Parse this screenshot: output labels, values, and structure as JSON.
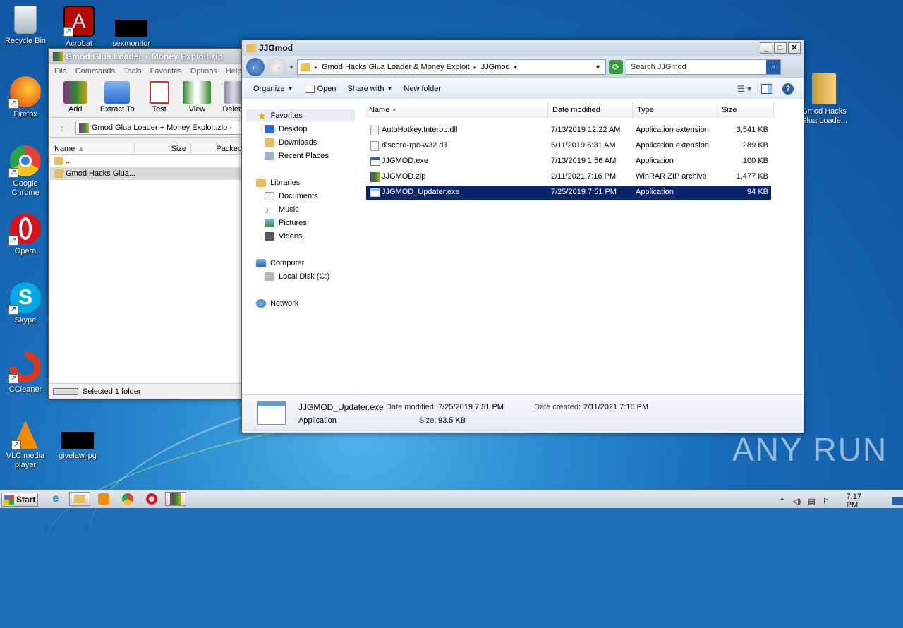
{
  "desktop": {
    "icons": [
      {
        "label": "Recycle Bin",
        "icon": "recycle-bin-icon",
        "color": "#cfd8e0"
      },
      {
        "label": "Firefox",
        "icon": "firefox-icon",
        "color": "#f07a20"
      },
      {
        "label": "Google Chrome",
        "icon": "chrome-icon",
        "color": "#e34133"
      },
      {
        "label": "Opera",
        "icon": "opera-icon",
        "color": "#d8121b"
      },
      {
        "label": "Skype",
        "icon": "skype-icon",
        "color": "#00a8e6"
      },
      {
        "label": "CCleaner",
        "icon": "ccleaner-icon",
        "color": "#d93a1e"
      },
      {
        "label": "VLC media player",
        "icon": "vlc-icon",
        "color": "#f28c00"
      },
      {
        "label": "Acrobat",
        "icon": "acrobat-icon",
        "color": "#b30b00"
      },
      {
        "label": "sexmonitor",
        "icon": "redacted-icon",
        "color": "#000000"
      },
      {
        "label": "givelaw.jpg",
        "icon": "image-thumbnail-icon",
        "color": "#000000"
      },
      {
        "label": "Gmod Hacks Glua Loade...",
        "icon": "folder-icon",
        "color": "#e8c060"
      }
    ],
    "watermark": "ANY RUN"
  },
  "winrar": {
    "title": "Gmod Glua Loader + Money Exploit.zip",
    "menu": [
      "File",
      "Commands",
      "Tools",
      "Favorites",
      "Options",
      "Help"
    ],
    "toolbar": [
      "Add",
      "Extract To",
      "Test",
      "View",
      "Delete"
    ],
    "path": "Gmod Glua Loader + Money Exploit.zip -",
    "columns": [
      "Name",
      "Size",
      "Packed"
    ],
    "rows": [
      "..",
      "Gmod Hacks Glua..."
    ],
    "status": "Selected 1 folder"
  },
  "explorer": {
    "title": "JJGmod",
    "breadcrumb": [
      "Gmod Hacks Glua Loader & Money Exploit",
      "JJGmod"
    ],
    "search_placeholder": "Search JJGmod",
    "toolbar": {
      "organize": "Organize",
      "open": "Open",
      "share": "Share with",
      "new_folder": "New folder"
    },
    "nav": {
      "favorites": "Favorites",
      "desktop": "Desktop",
      "downloads": "Downloads",
      "recent": "Recent Places",
      "libraries": "Libraries",
      "documents": "Documents",
      "music": "Music",
      "pictures": "Pictures",
      "videos": "Videos",
      "computer": "Computer",
      "local_disk": "Local Disk (C:)",
      "network": "Network"
    },
    "columns": {
      "name": "Name",
      "date": "Date modified",
      "type": "Type",
      "size": "Size"
    },
    "files": [
      {
        "name": "AutoHotkey.Interop.dll",
        "date": "7/13/2019 12:22 AM",
        "type": "Application extension",
        "size": "3,541 KB",
        "icon": "dll-icon"
      },
      {
        "name": "discord-rpc-w32.dll",
        "date": "6/11/2019 6:31 AM",
        "type": "Application extension",
        "size": "289 KB",
        "icon": "dll-icon"
      },
      {
        "name": "JJGMOD.exe",
        "date": "7/13/2019 1:56 AM",
        "type": "Application",
        "size": "100 KB",
        "icon": "exe-icon"
      },
      {
        "name": "JJGMOD.zip",
        "date": "2/11/2021 7:16 PM",
        "type": "WinRAR ZIP archive",
        "size": "1,477 KB",
        "icon": "winrar-icon"
      },
      {
        "name": "JJGMOD_Updater.exe",
        "date": "7/25/2019 7:51 PM",
        "type": "Application",
        "size": "94 KB",
        "icon": "exe-icon"
      }
    ],
    "details": {
      "name": "JJGMOD_Updater.exe",
      "type": "Application",
      "modified_label": "Date modified:",
      "modified": "7/25/2019 7:51 PM",
      "created_label": "Date created:",
      "created": "2/11/2021 7:16 PM",
      "size_label": "Size:",
      "size": "93.5 KB"
    }
  },
  "taskbar": {
    "start": "Start",
    "clock": "7:17 PM"
  }
}
